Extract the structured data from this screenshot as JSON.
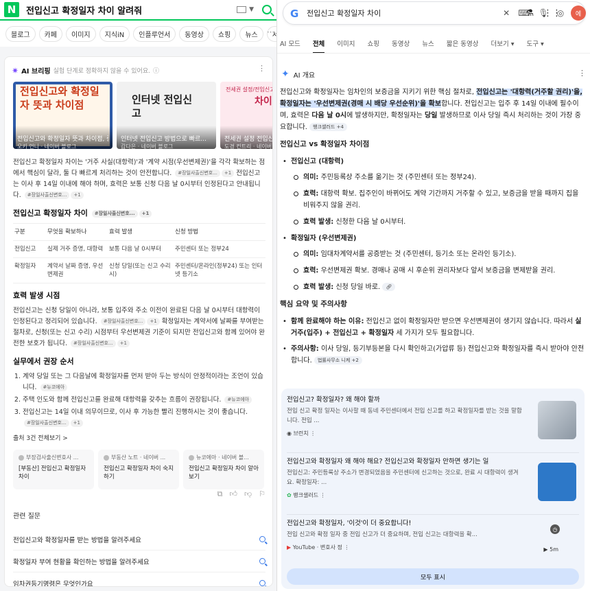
{
  "naver": {
    "query": "전입신고 확정일자 차이 알려줘",
    "logo": "N",
    "tabs": [
      "블로그",
      "카페",
      "이미지",
      "지식iN",
      "인플루언서",
      "동영상",
      "쇼핑",
      "뉴스",
      "서"
    ],
    "ai_title": "AI 브리핑",
    "ai_subtitle": "실험 단계로 정확하지 않을 수 있어요.",
    "thumbs": [
      {
        "text": "전입신고와 확정일자 뜻과 차이점",
        "cap": "전입신고와 확정일자 뜻과 차이점, 중요성",
        "src": "오키 언니 · 네이버 블로그"
      },
      {
        "text": "인터넷 전입신고",
        "cap": "인터넷 전입신고 방법으로 빠르...",
        "src": "갑다은 · 네이버 블로그"
      },
      {
        "small": "전세권 설정/전입신고",
        "text": "차이",
        "cap": "전세권 설정 전입신...",
        "src": "도경 컨트리 · 네이버"
      }
    ],
    "intro_1": "전입신고 확정일자 차이는 '거주 사실(대항력)'과 '계약 시점(우선변제권)'을 각각 확보하는 점에서 핵심이 달라, 둘 다 빠르게 처리하는 것이 안전합니다.",
    "intro_2": "전입신고는 이사 후 14일 이내에 해야 하며, 효력은 보통 신청 다음 날 0시부터 인정된다고 안내됩니다.",
    "chip": "#장일사출신변호...",
    "chip_count": "+1",
    "table_title": "전입신고 확정일자 차이",
    "table": {
      "headers": [
        "구분",
        "무엇을 확보하나",
        "효력 발생",
        "신청 방법"
      ],
      "rows": [
        [
          "전입신고",
          "실제 거주 증명, 대항력",
          "보통 다음 날 0시부터",
          "주민센터 또는 정부24"
        ],
        [
          "확정일자",
          "계약서 날짜 증명, 우선 변제권",
          "신청 당일(또는 신고 수리 시)",
          "주민센터/온라인(정부24) 또는 인터넷 등기소"
        ]
      ]
    },
    "effect_title": "효력 발생 시점",
    "effect_1": "전입신고는 신청 당일이 아니라, 보통 입주와 주소 이전이 완료된 다음 날 0시부터 대항력이 인정된다고 정리되어 있습니다.",
    "effect_2": "확정일자는 계약서에 날짜를 부여받는 절차로, 신청(또는 신고 수리) 시점부터 우선변제권 기준이 되지만 전입신고와 함께 있어야 완전한 보호가 됩니다.",
    "practice_title": "실무에서 권장 순서",
    "practice": [
      "계약 당일 또는 그 다음날에 확정일자를 먼저 받아 두는 방식이 안정적이라는 조언이 있습니다.",
      "주택 인도와 함께 전입신고를 완료해 대항력을 갖추는 흐름이 권장됩니다.",
      "전입신고는 14일 이내 의무이므로, 이사 후 가능한 빨리 진행하시는 것이 좋습니다."
    ],
    "chip_b": "#뉴코에아",
    "src_all": "출처 3건 전체보기 >",
    "src_cards": [
      {
        "who": "부장검사출신변호사 ...",
        "title": "[부동산] 전입신고 확정일자 차이"
      },
      {
        "who": "부동산 노트 · 네이버 ...",
        "title": "전입신고 확정일자 차이 숙지하기"
      },
      {
        "who": "뉴코에아 · 네이버 블...",
        "title": "전입신고 확정일자 차이 알아보기"
      }
    ],
    "related_title": "관련 질문",
    "related": [
      "전입신고와 확정일자를 받는 방법을 알려주세요",
      "확정일자 부여 현황을 확인하는 방법을 알려주세요",
      "임차권등기명령은 무엇인가요"
    ]
  },
  "google": {
    "query": "전입신고 확정일자 차이",
    "avatar": "에",
    "tabs": [
      "AI 모드",
      "전체",
      "이미지",
      "쇼핑",
      "동영상",
      "뉴스",
      "짧은 동영상",
      "더보기",
      "도구"
    ],
    "active_tab": "전체",
    "ai_title": "AI 개요",
    "intro_a": "전입신고와 확정일자는 임차인의 보증금을 지키기 위한 핵심 절차로,",
    "intro_hl": "전입신고는 '대항력(거주할 권리)'을, 확정일자는 '우선변제권(경매 시 배당 우선순위)'을 확보",
    "intro_b": "합니다. 전입신고는 입주 후 14일 이내에 필수이며, 효력은",
    "intro_bold1": "다음 날 0시",
    "intro_c": "에 발생하지만, 확정일자는",
    "intro_bold2": "당일",
    "intro_d": "발생하므로 이사 당일 즉시 처리하는 것이 가장 중요합니다.",
    "chip1": "뱅크샐러드 +4",
    "vs_title": "전입신고 vs 확정일자 차이점",
    "s1_title": "전입신고 (대항력)",
    "s1": [
      {
        "k": "의미:",
        "v": "주민등록상 주소를 옮기는 것 (주민센터 또는 정부24)."
      },
      {
        "k": "효력:",
        "v": "대항력 확보. 집주인이 바뀌어도 계약 기간까지 거주할 수 있고, 보증금을 받을 때까지 집을 비워주지 않을 권리."
      },
      {
        "k": "효력 발생:",
        "v": "신청한 다음 날 0시부터."
      }
    ],
    "s2_title": "확정일자 (우선변제권)",
    "s2": [
      {
        "k": "의미:",
        "v": "임대차계약서를 공증받는 것 (주민센터, 등기소 또는 온라인 등기소)."
      },
      {
        "k": "효력:",
        "v": "우선변제권 확보. 경매나 공매 시 후순위 권리자보다 앞서 보증금을 변제받을 권리."
      },
      {
        "k": "효력 발생:",
        "v": "신청 당일 바로."
      }
    ],
    "summary_title": "핵심 요약 및 주의사항",
    "sum1_k": "함께 완료해야 하는 이유:",
    "sum1_v": "전입신고 없이 확정일자만 받으면 우선변제권이 생기지 않습니다. 따라서",
    "sum1_b": "실거주(입주) + 전입신고 + 확정일자",
    "sum1_e": "세 가지가 모두 필요합니다.",
    "sum2_k": "주의사항:",
    "sum2_v": "이사 당일, 등기부등본을 다시 확인하고(가압류 등) 전입신고와 확정일자를 즉시 받아야 안전합니다.",
    "chip2": "법률사무소 니케 +2",
    "cards": [
      {
        "title": "전입신고? 확정일자? 왜 해야 할까",
        "desc": "전입 신고 확정 일자는 이사할 때 동네 주민센터에서 전입 신고를 하고 확정일자를 받는 것을 말합니다. 전입 ...",
        "src": "브런치"
      },
      {
        "title": "전입신고와 확정일자 왜 해야 해요? 전입신고와 확정일자 안하면 생기는 일",
        "desc": "전입신고: 주민등록상 주소가 변경되었음을 주민센터에 신고하는 것으로, 완료 시 대항력이 생겨요. 확정일자: ...",
        "src": "뱅크샐러드"
      },
      {
        "title": "전입신고와 확정일자, '이것'이 더 중요합니다!",
        "desc": "전입 신고와 확정 일자 중 전입 신고가 더 중요하며, 전입 신고는 대항력을 확...",
        "src": "YouTube · 변호사 정",
        "duration": "5m"
      }
    ],
    "show_all": "모두 표시"
  }
}
